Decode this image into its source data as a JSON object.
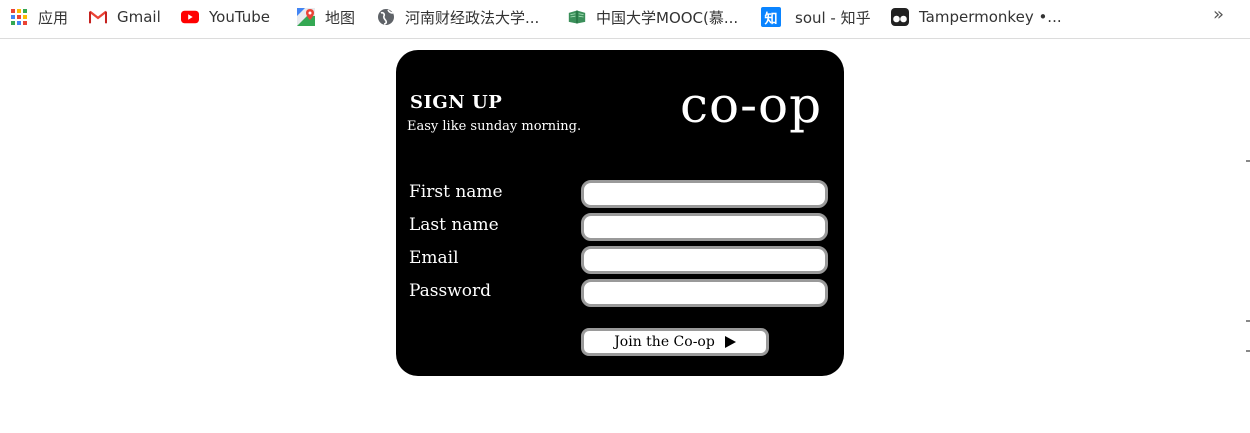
{
  "bookmarks": [
    {
      "label": "应用",
      "icon": "apps-grid-icon"
    },
    {
      "label": "Gmail",
      "icon": "gmail-icon"
    },
    {
      "label": "YouTube",
      "icon": "youtube-icon"
    },
    {
      "label": "地图",
      "icon": "maps-icon"
    },
    {
      "label": "河南财经政法大学...",
      "icon": "globe-icon"
    },
    {
      "label": "中国大学MOOC(慕...",
      "icon": "mooc-icon"
    },
    {
      "label": "soul - 知乎",
      "icon": "zhihu-icon"
    },
    {
      "label": "Tampermonkey •...",
      "icon": "tampermonkey-icon"
    }
  ],
  "bookmarks_overflow": "»",
  "signup": {
    "title": "SIGN UP",
    "subtitle": "Easy like sunday morning.",
    "logo": "co-op",
    "fields": [
      {
        "label": "First name",
        "value": ""
      },
      {
        "label": "Last name",
        "value": ""
      },
      {
        "label": "Email",
        "value": ""
      },
      {
        "label": "Password",
        "value": ""
      }
    ],
    "submit_label": "Join the Co-op"
  },
  "colors": {
    "card_background": "#000000",
    "text": "#ffffff",
    "input_border": "#9a9a9a"
  }
}
